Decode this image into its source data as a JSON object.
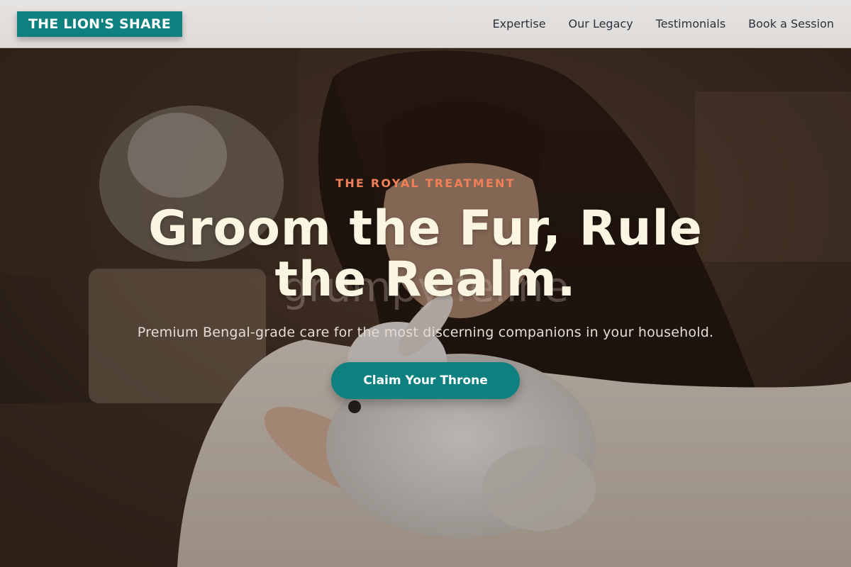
{
  "header": {
    "logo": "THE LION'S SHARE",
    "nav": [
      {
        "label": "Expertise"
      },
      {
        "label": "Our Legacy"
      },
      {
        "label": "Testimonials"
      },
      {
        "label": "Book a Session"
      }
    ]
  },
  "hero": {
    "eyebrow": "THE ROYAL TREATMENT",
    "headline": "Groom the Fur, Rule the Realm.",
    "ghost_text": "grumpy feline",
    "subtitle": "Premium Bengal-grade care for the most discerning companions in your household.",
    "cta_label": "Claim Your Throne"
  },
  "colors": {
    "brand_teal": "#0e807f",
    "eyebrow_coral": "#ef8058",
    "headline_cream": "#fbf6e1"
  }
}
